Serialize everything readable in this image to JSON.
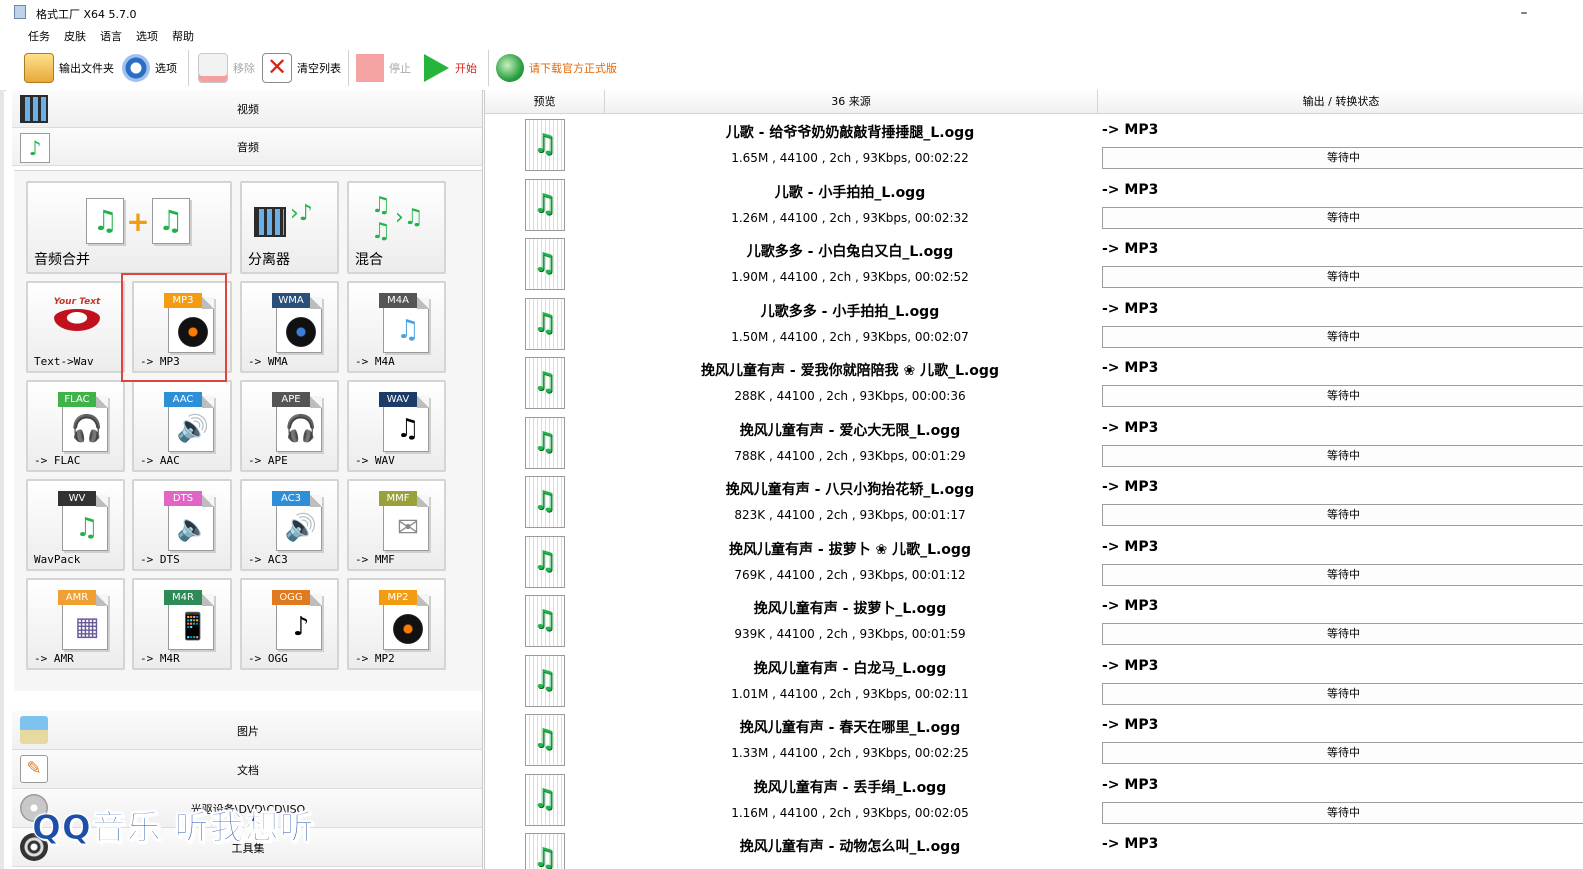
{
  "window": {
    "title": "格式工厂 X64 5.7.0",
    "minimize": "–"
  },
  "menu": [
    "任务",
    "皮肤",
    "语言",
    "选项",
    "帮助"
  ],
  "toolbar": {
    "output_folder": "输出文件夹",
    "options": "选项",
    "remove": "移除",
    "clear_list": "清空列表",
    "stop": "停止",
    "start": "开始",
    "download": "请下载官方正式版"
  },
  "categories": {
    "video": "视频",
    "audio": "音频",
    "image": "图片",
    "document": "文档",
    "dvd": "光驱设备\\DVD\\CD\\ISO",
    "tools": "工具集"
  },
  "audio_tools": [
    {
      "label": "音频合并"
    },
    {
      "label": "分离器"
    },
    {
      "label": "混合"
    },
    {
      "label": "Text->Wav",
      "badge_text": "Your Text"
    },
    {
      "label": "-> MP3",
      "badge": "MP3",
      "color": "#f39c12"
    },
    {
      "label": "-> WMA",
      "badge": "WMA",
      "color": "#2a4f7a"
    },
    {
      "label": "-> M4A",
      "badge": "M4A",
      "color": "#555555"
    },
    {
      "label": "-> FLAC",
      "badge": "FLAC",
      "color": "#3fb24a"
    },
    {
      "label": "-> AAC",
      "badge": "AAC",
      "color": "#2d8fd6"
    },
    {
      "label": "-> APE",
      "badge": "APE",
      "color": "#555555"
    },
    {
      "label": "-> WAV",
      "badge": "WAV",
      "color": "#1c3b69"
    },
    {
      "label": "WavPack",
      "badge": "WV",
      "color": "#333333"
    },
    {
      "label": "-> DTS",
      "badge": "DTS",
      "color": "#e065c4"
    },
    {
      "label": "-> AC3",
      "badge": "AC3",
      "color": "#2d8fd6"
    },
    {
      "label": "-> MMF",
      "badge": "MMF",
      "color": "#9aa03a"
    },
    {
      "label": "-> AMR",
      "badge": "AMR",
      "color": "#f0a030"
    },
    {
      "label": "-> M4R",
      "badge": "M4R",
      "color": "#2e8b57"
    },
    {
      "label": "-> OGG",
      "badge": "OGG",
      "color": "#e07a20"
    },
    {
      "label": "-> MP2",
      "badge": "MP2",
      "color": "#f39c12"
    }
  ],
  "watermark": "QQ音乐 听我想听",
  "list": {
    "headers": {
      "preview": "预览",
      "source": "36 来源",
      "output_status": "输出 / 转换状态"
    },
    "files": [
      {
        "name": "儿歌 - 给爷爷奶奶敲敲背捶捶腿_L.ogg",
        "info": "1.65M , 44100 , 2ch , 93Kbps, 00:02:22",
        "out": "-> MP3",
        "status": "等待中"
      },
      {
        "name": "儿歌 - 小手拍拍_L.ogg",
        "info": "1.26M , 44100 , 2ch , 93Kbps, 00:02:32",
        "out": "-> MP3",
        "status": "等待中"
      },
      {
        "name": "儿歌多多 - 小白兔白又白_L.ogg",
        "info": "1.90M , 44100 , 2ch , 93Kbps, 00:02:52",
        "out": "-> MP3",
        "status": "等待中"
      },
      {
        "name": "儿歌多多 - 小手拍拍_L.ogg",
        "info": "1.50M , 44100 , 2ch , 93Kbps, 00:02:07",
        "out": "-> MP3",
        "status": "等待中"
      },
      {
        "name": "挽风儿童有声 - 爱我你就陪陪我 ❀ 儿歌_L.ogg",
        "info": "288K , 44100 , 2ch , 93Kbps, 00:00:36",
        "out": "-> MP3",
        "status": "等待中"
      },
      {
        "name": "挽风儿童有声 - 爱心大无限_L.ogg",
        "info": "788K , 44100 , 2ch , 93Kbps, 00:01:29",
        "out": "-> MP3",
        "status": "等待中"
      },
      {
        "name": "挽风儿童有声 - 八只小狗抬花轿_L.ogg",
        "info": "823K , 44100 , 2ch , 93Kbps, 00:01:17",
        "out": "-> MP3",
        "status": "等待中"
      },
      {
        "name": "挽风儿童有声 - 拔萝卜 ❀ 儿歌_L.ogg",
        "info": "769K , 44100 , 2ch , 93Kbps, 00:01:12",
        "out": "-> MP3",
        "status": "等待中"
      },
      {
        "name": "挽风儿童有声 - 拔萝卜_L.ogg",
        "info": "939K , 44100 , 2ch , 93Kbps, 00:01:59",
        "out": "-> MP3",
        "status": "等待中"
      },
      {
        "name": "挽风儿童有声 - 白龙马_L.ogg",
        "info": "1.01M , 44100 , 2ch , 93Kbps, 00:02:11",
        "out": "-> MP3",
        "status": "等待中"
      },
      {
        "name": "挽风儿童有声 - 春天在哪里_L.ogg",
        "info": "1.33M , 44100 , 2ch , 93Kbps, 00:02:25",
        "out": "-> MP3",
        "status": "等待中"
      },
      {
        "name": "挽风儿童有声 - 丢手绢_L.ogg",
        "info": "1.16M , 44100 , 2ch , 93Kbps, 00:02:05",
        "out": "-> MP3",
        "status": "等待中"
      },
      {
        "name": "挽风儿童有声 - 动物怎么叫_L.ogg",
        "info": "",
        "out": "-> MP3",
        "status": ""
      }
    ]
  }
}
